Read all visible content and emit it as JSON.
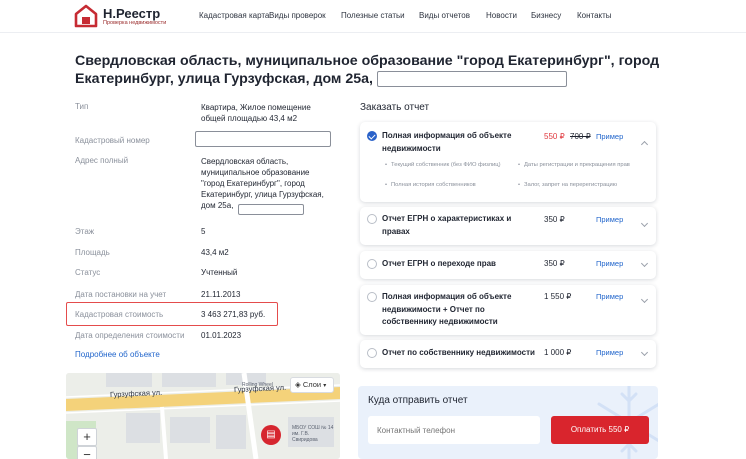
{
  "header": {
    "logo_name": "Н.Реестр",
    "logo_subtitle": "Проверка недвижимости",
    "nav": [
      "Кадастровая карта",
      "Виды проверок",
      "Полезные статьи",
      "Виды отчетов",
      "Новости",
      "Бизнесу",
      "Контакты"
    ]
  },
  "title": "Свердловская область, муниципальное образование \"город Екатеринбург\", город Екатеринбург, улица Гурзуфская, дом 25а,",
  "properties": {
    "type_label": "Тип",
    "type_value": "Квартира, Жилое помещение общей площадью 43,4 м2",
    "cadastral_number_label": "Кадастровый номер",
    "address_label": "Адрес полный",
    "address_value": "Свердловская область, муниципальное образование \"город Екатеринбург\", город Екатеринбург, улица Гурзуфская, дом 25а,",
    "floor_label": "Этаж",
    "floor_value": "5",
    "area_label": "Площадь",
    "area_value": "43,4 м2",
    "status_label": "Статус",
    "status_value": "Учтенный",
    "registration_date_label": "Дата постановки на учет",
    "registration_date_value": "21.11.2013",
    "cadastral_value_label": "Кадастровая стоимость",
    "cadastral_value_value": "3 463 271,83 руб.",
    "valuation_date_label": "Дата определения стоимости",
    "valuation_date_value": "01.01.2023",
    "more_link": "Подробнее об объекте"
  },
  "map": {
    "street_label_1": "Гурзуфская ул.",
    "street_label_2": "Гурзуфская ул.",
    "poi_1": "Rolling Wheel",
    "poi_2": "МБОУ СОШ № 14 им. Г.В. Свиридова",
    "layers_label": "Слои",
    "zoom_in": "+",
    "zoom_out": "−"
  },
  "order": {
    "title": "Заказать отчет",
    "example_label": "Пример",
    "options": [
      {
        "name": "Полная информация об объекте недвижимости",
        "price": "550 ₽",
        "old_price": "700 ₽",
        "checked": true,
        "bullets": [
          "Текущий собственник (без ФИО физлиц)",
          "Полная история собственников",
          "Даты регистрации и прекращения прав",
          "Залог, запрет на перерегистрацию"
        ]
      },
      {
        "name": "Отчет ЕГРН о характеристиках и правах",
        "price": "350 ₽",
        "checked": false
      },
      {
        "name": "Отчет ЕГРН о переходе прав",
        "price": "350 ₽",
        "checked": false
      },
      {
        "name": "Полная информация об объекте недвижимости + Отчет по собственнику недвижимости",
        "price": "1 550 ₽",
        "checked": false
      },
      {
        "name": "Отчет по собственнику недвижимости",
        "price": "1 000 ₽",
        "checked": false
      }
    ]
  },
  "send": {
    "title": "Куда отправить отчет",
    "phone_placeholder": "Контактный телефон",
    "pay_button": "Оплатить 550 ₽"
  },
  "colors": {
    "accent_red": "#d9252d",
    "link_blue": "#2266cc",
    "highlight_border": "#e44c4c",
    "send_background": "#eaf1fb"
  }
}
